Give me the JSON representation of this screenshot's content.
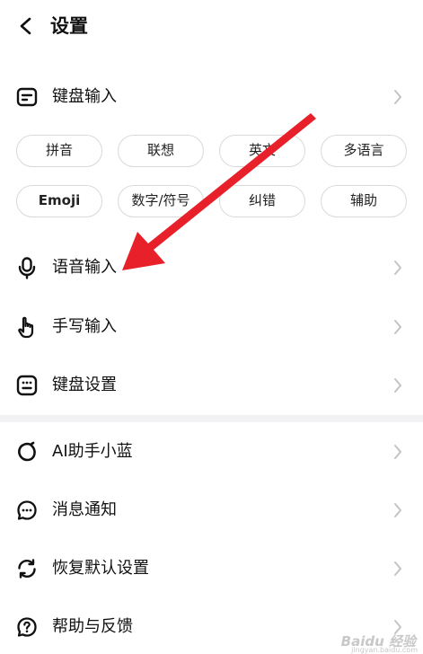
{
  "header": {
    "title": "设置",
    "back_icon": "chevron-left-icon"
  },
  "keyboard_input": {
    "label": "键盘输入",
    "icon": "keyboard-card-icon",
    "chips": [
      "拼音",
      "联想",
      "英文",
      "多语言",
      "Emoji",
      "数字/符号",
      "纠错",
      "辅助"
    ]
  },
  "rows": [
    {
      "label": "语音输入",
      "icon": "microphone-icon"
    },
    {
      "label": "手写输入",
      "icon": "hand-pointer-icon"
    },
    {
      "label": "键盘设置",
      "icon": "keyboard-grid-icon"
    },
    {
      "label": "AI助手小蓝",
      "icon": "ai-ring-icon"
    },
    {
      "label": "消息通知",
      "icon": "message-dots-icon"
    },
    {
      "label": "恢复默认设置",
      "icon": "reset-icon"
    },
    {
      "label": "帮助与反馈",
      "icon": "help-icon"
    }
  ],
  "colors": {
    "arrow": "#e8202a",
    "chip_border": "#d9d9d9",
    "divider": "#f2f2f5",
    "chevron": "#c4c4c4"
  },
  "watermark": {
    "text": "Baidu 经验",
    "sub": "jingyan.baidu.com"
  }
}
